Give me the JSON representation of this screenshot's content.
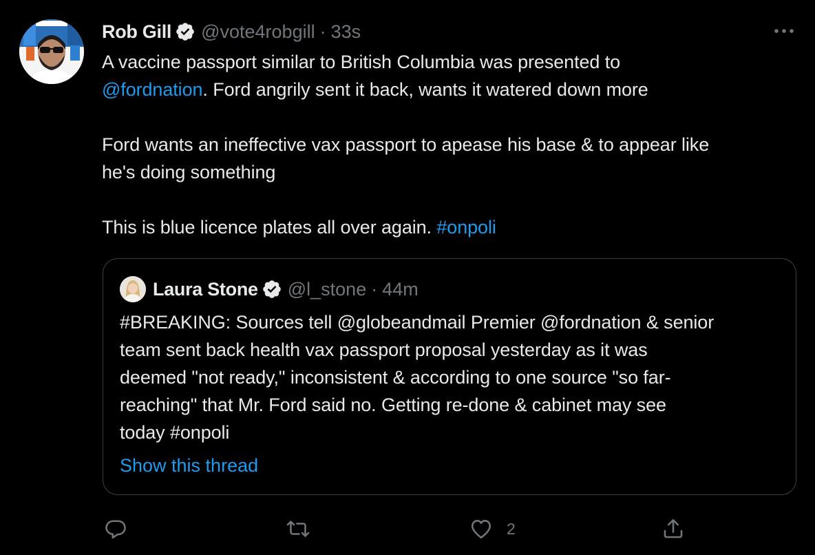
{
  "tweet": {
    "author_name": "Rob Gill",
    "author_handle": "@vote4robgill",
    "separator": "·",
    "time": "33s",
    "lines": [
      {
        "parts": [
          {
            "text": "A vaccine passport similar to British Columbia was presented to",
            "link": false
          }
        ]
      },
      {
        "parts": [
          {
            "text": "@fordnation",
            "link": true
          },
          {
            "text": ". Ford angrily sent it back, wants it watered down more",
            "link": false
          }
        ]
      },
      {
        "blank": true
      },
      {
        "parts": [
          {
            "text": "Ford wants an ineffective vax passport to apease his base & to appear like",
            "link": false
          }
        ]
      },
      {
        "parts": [
          {
            "text": "he's doing something",
            "link": false
          }
        ]
      },
      {
        "blank": true
      },
      {
        "parts": [
          {
            "text": "This is blue licence plates all over again. ",
            "link": false
          },
          {
            "text": "#onpoli",
            "link": true
          }
        ]
      }
    ]
  },
  "quote": {
    "author_name": "Laura Stone",
    "author_handle": "@l_stone",
    "separator": "·",
    "time": "44m",
    "lines": [
      "#BREAKING: Sources tell @globeandmail Premier @fordnation & senior",
      "team sent back health vax passport proposal yesterday as it was",
      "deemed \"not ready,\" inconsistent & according to one source \"so far-",
      "reaching\" that Mr. Ford said no. Getting re-done & cabinet may see",
      "today #onpoli"
    ],
    "show_thread": "Show this thread"
  },
  "actions": {
    "like_count": "2"
  },
  "icons": {
    "verified": "verified-badge-icon",
    "more": "more-options-icon",
    "reply": "reply-icon",
    "retweet": "retweet-icon",
    "like": "like-icon",
    "share": "share-icon"
  },
  "colors": {
    "background": "#000000",
    "text": "#e7e9ea",
    "secondary": "#71767b",
    "link": "#1d9bf0",
    "border": "#3e4144"
  }
}
